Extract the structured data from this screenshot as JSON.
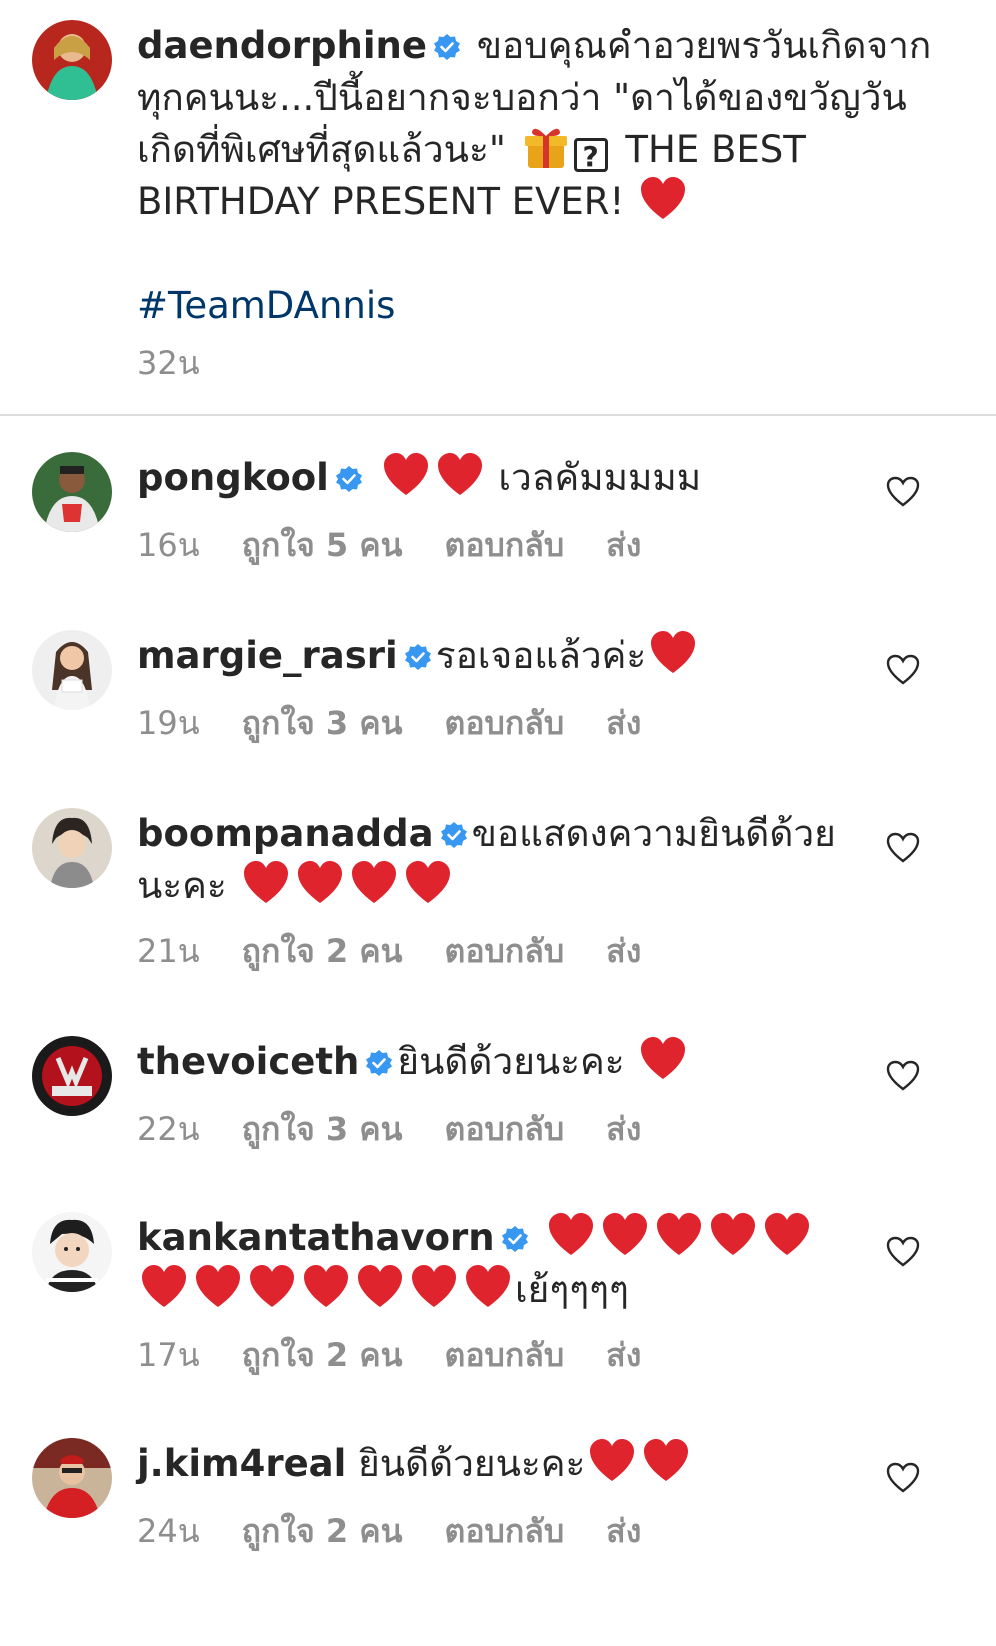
{
  "caption": {
    "username": "daendorphine",
    "text_part1": "ขอบคุณคำอวยพรวันเกิดจากทุกคนนะ...ปีนี้อยากจะบอกว่า \"ดาได้ของขวัญวันเกิดที่พิเศษที่สุดแล้วนะ\"",
    "unknown_glyph": "?",
    "text_part2": "THE BEST BIRTHDAY PRESENT EVER!",
    "hashtag": "#TeamDAnnis",
    "time": "32น"
  },
  "labels": {
    "likes_prefix": "ถูกใจ",
    "likes_suffix": "คน",
    "reply": "ตอบกลับ",
    "send": "ส่ง"
  },
  "comments": [
    {
      "username": "pongkool",
      "text": "เวลคัมมมมม",
      "time": "16น",
      "likes": "5"
    },
    {
      "username": "margie_rasri",
      "text": "รอเจอแล้วค่ะ",
      "time": "19น",
      "likes": "3"
    },
    {
      "username": "boompanadda",
      "text": "ขอแสดงความยินดีด้วยนะคะ",
      "time": "21น",
      "likes": "2"
    },
    {
      "username": "thevoiceth",
      "text": "ยินดีด้วยนะคะ",
      "time": "22น",
      "likes": "3"
    },
    {
      "username": "kankantathavorn",
      "text": "เย้ๆๆๆๆ",
      "time": "17น",
      "likes": "2"
    },
    {
      "username": "j.kim4real",
      "text": "ยินดีด้วยนะคะ",
      "time": "24น",
      "likes": "2"
    }
  ],
  "icons": {
    "verified": "verified-badge-icon",
    "like": "heart-outline-icon",
    "heart_emoji": "red-heart-emoji",
    "gift_emoji": "gift-emoji"
  },
  "colors": {
    "username": "#262626",
    "secondary": "#8e8e8e",
    "hashtag": "#00376b",
    "verified": "#3897f0",
    "heart": "#e0242e",
    "divider": "#dbdbdb"
  }
}
